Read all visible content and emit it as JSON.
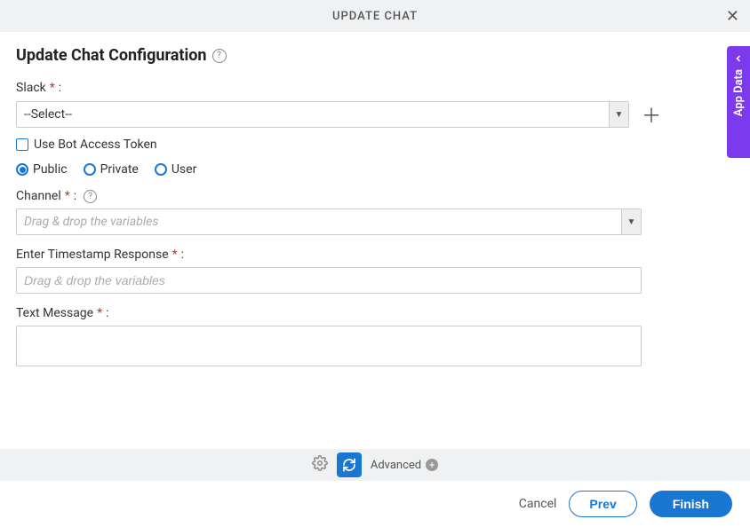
{
  "header": {
    "title": "UPDATE CHAT"
  },
  "page": {
    "title": "Update Chat Configuration"
  },
  "fields": {
    "slack": {
      "label": "Slack",
      "colon": ":",
      "select_text": "--Select--"
    },
    "use_bot": {
      "label": "Use Bot Access Token"
    },
    "scope": {
      "public": "Public",
      "private": "Private",
      "user": "User"
    },
    "channel": {
      "label": "Channel",
      "colon": ":",
      "placeholder": "Drag & drop the variables"
    },
    "timestamp": {
      "label": "Enter Timestamp Response",
      "colon": ":",
      "placeholder": "Drag & drop the variables"
    },
    "textmsg": {
      "label": "Text Message",
      "colon": ":"
    }
  },
  "footer": {
    "advanced": "Advanced"
  },
  "buttons": {
    "cancel": "Cancel",
    "prev": "Prev",
    "finish": "Finish"
  },
  "side": {
    "label": "App Data"
  },
  "required_mark": "*"
}
